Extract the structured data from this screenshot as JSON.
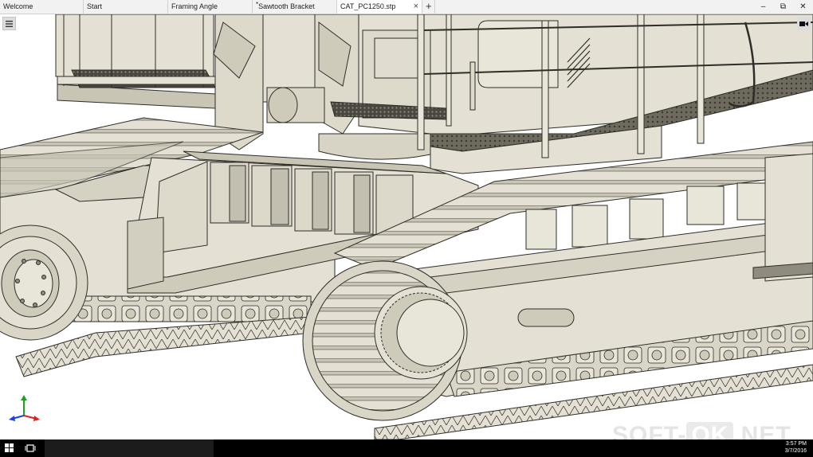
{
  "tabs": [
    {
      "label": "Welcome",
      "active": false,
      "modified": false
    },
    {
      "label": "Start",
      "active": false,
      "modified": false
    },
    {
      "label": "Framing Angle",
      "active": false,
      "modified": false
    },
    {
      "label": "Sawtooth Bracket",
      "active": false,
      "modified": true
    },
    {
      "label": "CAT_PC1250.stp",
      "active": true,
      "modified": false
    }
  ],
  "tab_bar": {
    "add_label": "+",
    "close_glyph": "×",
    "modified_marker": "*"
  },
  "window_controls": {
    "minimize": "–",
    "restore": "⧉",
    "close": "✕"
  },
  "viewport": {
    "menu_icon": "hamburger-icon",
    "camera_icon": "camera-icon",
    "triad_colors": {
      "z": "#22a022",
      "x": "#e02020",
      "y": "#2040e0"
    }
  },
  "taskbar": {
    "time": "3:57 PM",
    "date": "3/7/2016"
  },
  "watermark": {
    "left": "SOFT-",
    "box": "OK",
    "right": ".NET"
  },
  "colors": {
    "model_fill": "#e4e1d4",
    "model_shade": "#c9c5b5",
    "model_dark": "#8f8b7e",
    "edge": "#2f2d28",
    "background": "#ffffff",
    "taskbar": "#000000"
  }
}
